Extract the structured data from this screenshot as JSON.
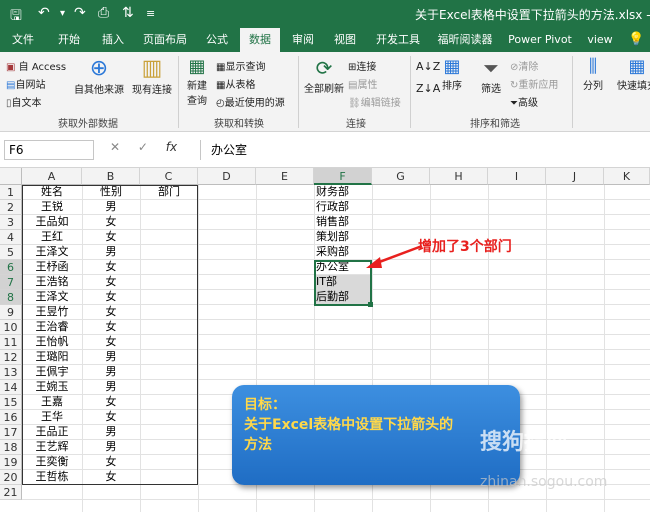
{
  "titlebar": {
    "title": "关于Excel表格中设置下拉箭头的方法.xlsx  -  Exc",
    "save_icon": "save-icon",
    "undo_icon": "undo-icon"
  },
  "tabs": [
    "文件",
    "开始",
    "插入",
    "页面布局",
    "公式",
    "数据",
    "审阅",
    "视图",
    "开发工具",
    "福昕阅读器",
    "Power Pivot",
    "view"
  ],
  "active_tab": "数据",
  "ribbon": {
    "get_external": {
      "access": "自 Access",
      "website": "自网站",
      "text": "自文本",
      "other": "自其他来源",
      "existing": "现有连接",
      "label": "获取外部数据"
    },
    "get_transform": {
      "new_query": "新建",
      "new_query2": "查询",
      "show_queries": "显示查询",
      "from_table": "从表格",
      "recent": "最近使用的源",
      "label": "获取和转换"
    },
    "connections": {
      "refresh_all": "全部刷新",
      "connections": "连接",
      "properties": "属性",
      "edit_links": "编辑链接",
      "label": "连接"
    },
    "sort_filter": {
      "sort": "排序",
      "filter": "筛选",
      "clear": "清除",
      "reapply": "重新应用",
      "advanced": "高级",
      "label": "排序和筛选"
    },
    "tools": {
      "split": "分列",
      "flash_fill": "快速填充"
    }
  },
  "formula_bar": {
    "name_box": "F6",
    "fx": "fx",
    "value": "办公室"
  },
  "columns": [
    "A",
    "B",
    "C",
    "D",
    "E",
    "F",
    "G",
    "H",
    "I",
    "J",
    "K"
  ],
  "rows": [
    "1",
    "2",
    "3",
    "4",
    "5",
    "6",
    "7",
    "8",
    "9",
    "10",
    "11",
    "12",
    "13",
    "14",
    "15",
    "16",
    "17",
    "18",
    "19",
    "20",
    "21"
  ],
  "table": {
    "headers": [
      "姓名",
      "性别",
      "部门"
    ],
    "data": [
      [
        "王锐",
        "男"
      ],
      [
        "王品如",
        "女"
      ],
      [
        "王红",
        "女"
      ],
      [
        "王泽文",
        "男"
      ],
      [
        "王杼函",
        "女"
      ],
      [
        "王浩铭",
        "女"
      ],
      [
        "王泽文",
        "女"
      ],
      [
        "王昱竹",
        "女"
      ],
      [
        "王治睿",
        "女"
      ],
      [
        "王怡帆",
        "女"
      ],
      [
        "王璐阳",
        "男"
      ],
      [
        "王佩宇",
        "男"
      ],
      [
        "王婉玉",
        "男"
      ],
      [
        "王嘉",
        "女"
      ],
      [
        "王华",
        "女"
      ],
      [
        "王品正",
        "男"
      ],
      [
        "王艺辉",
        "男"
      ],
      [
        "王奕衡",
        "女"
      ],
      [
        "王哲栋",
        "女"
      ]
    ]
  },
  "departments": [
    "财务部",
    "行政部",
    "销售部",
    "策划部",
    "采购部",
    "办公室",
    "IT部",
    "后勤部"
  ],
  "annotation": "增加了3个部门",
  "goal": {
    "line1": "目标：",
    "line2": "关于Excel表格中设置下拉箭头的",
    "line3": "方法"
  },
  "watermark": "搜狗指南",
  "watermark_url": "zhinan.sogou.com",
  "colors": {
    "excel_green": "#217346",
    "annotation_red": "#e8201e",
    "goal_blue": "#2a7fd6",
    "goal_text": "#ffd84a"
  }
}
